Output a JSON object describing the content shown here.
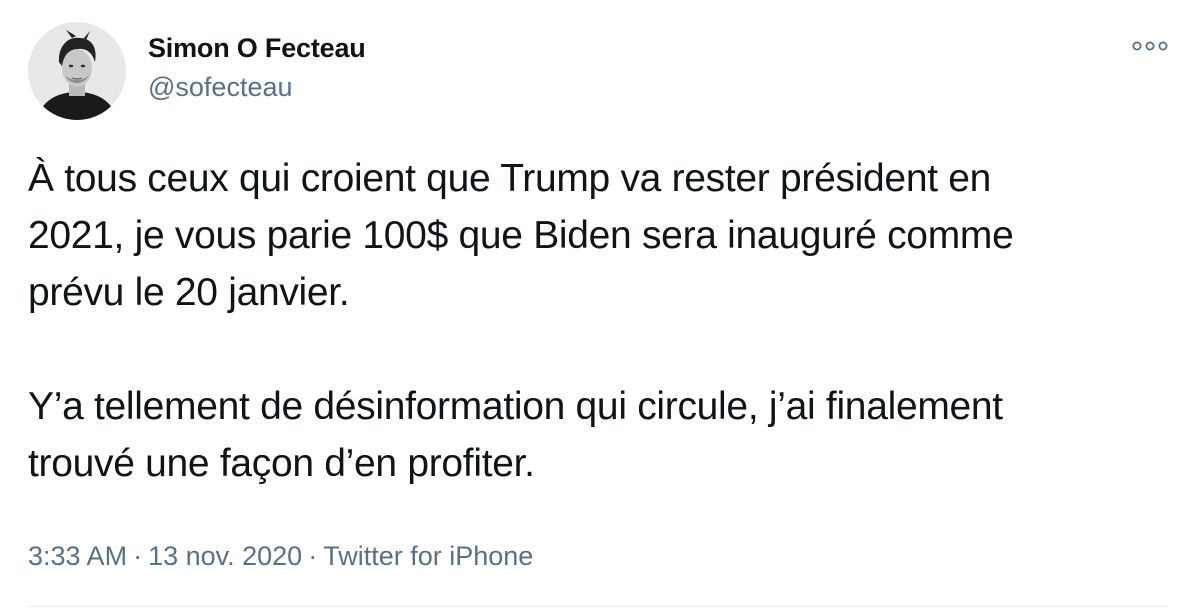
{
  "tweet": {
    "author": {
      "display_name": "Simon O Fecteau",
      "handle": "@sofecteau",
      "avatar_icon": "user-photo"
    },
    "more_icon": "more-horizontal-icon",
    "paragraphs": [
      "À tous ceux qui croient que Trump va rester président en\n2021, je vous parie 100$ que Biden sera inauguré comme\nprévu le 20 janvier.",
      "Y’a tellement de désinformation qui circule, j’ai finalement\ntrouvé une façon d’en profiter."
    ],
    "time": "3:33 AM",
    "separator": "·",
    "date": "13 nov. 2020",
    "source": "Twitter for iPhone"
  },
  "colors": {
    "text_primary": "#0f1419",
    "text_secondary": "#5b7083",
    "divider": "#e6ecf0",
    "background": "#ffffff"
  }
}
